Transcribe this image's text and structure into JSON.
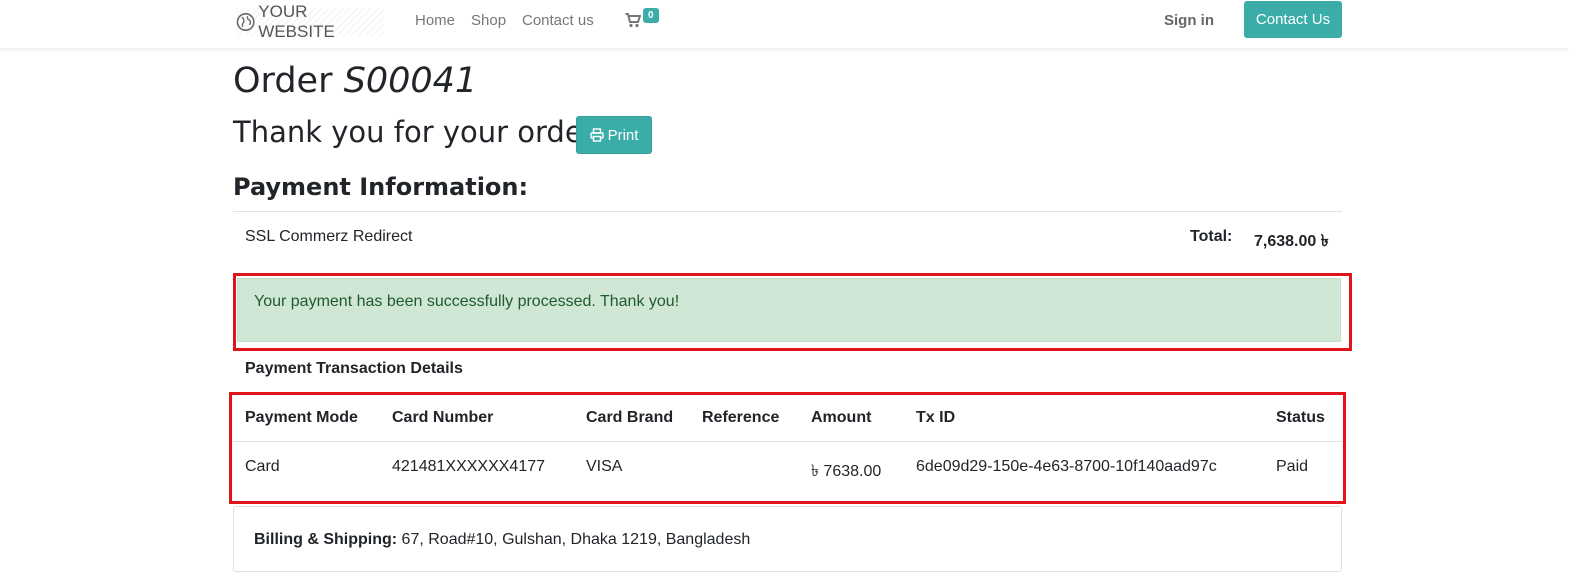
{
  "navbar": {
    "brand": "YOUR WEBSITE",
    "links": [
      "Home",
      "Shop",
      "Contact us"
    ],
    "cart_count": "0",
    "sign_in": "Sign in",
    "contact_button": "Contact Us"
  },
  "order": {
    "title_prefix": "Order",
    "number": "S00041",
    "thanks": "Thank you for your order.",
    "print_label": "Print"
  },
  "payment": {
    "heading": "Payment Information:",
    "provider": "SSL Commerz Redirect",
    "total_label": "Total:",
    "total_value": "7,638.00 ৳",
    "success_message": "Your payment has been successfully processed. Thank you!"
  },
  "transaction": {
    "heading": "Payment Transaction Details",
    "columns": [
      "Payment Mode",
      "Card Number",
      "Card Brand",
      "Reference",
      "Amount",
      "Tx ID",
      "Status"
    ],
    "row": {
      "mode": "Card",
      "card_number": "421481XXXXXX4177",
      "brand": "VISA",
      "reference": "",
      "amount": "৳ 7638.00",
      "tx_id": "6de09d29-150e-4e63-8700-10f140aad97c",
      "status": "Paid"
    }
  },
  "billing": {
    "label": "Billing & Shipping:",
    "address": "67, Road#10, Gulshan, Dhaka 1219, Bangladesh"
  },
  "colors": {
    "accent": "#3aada8",
    "success_bg": "#d1e7d6",
    "success_text": "#1e5b2c",
    "highlight_border": "#e0141b"
  },
  "icons": [
    "globe-icon",
    "cart-icon",
    "print-icon"
  ]
}
